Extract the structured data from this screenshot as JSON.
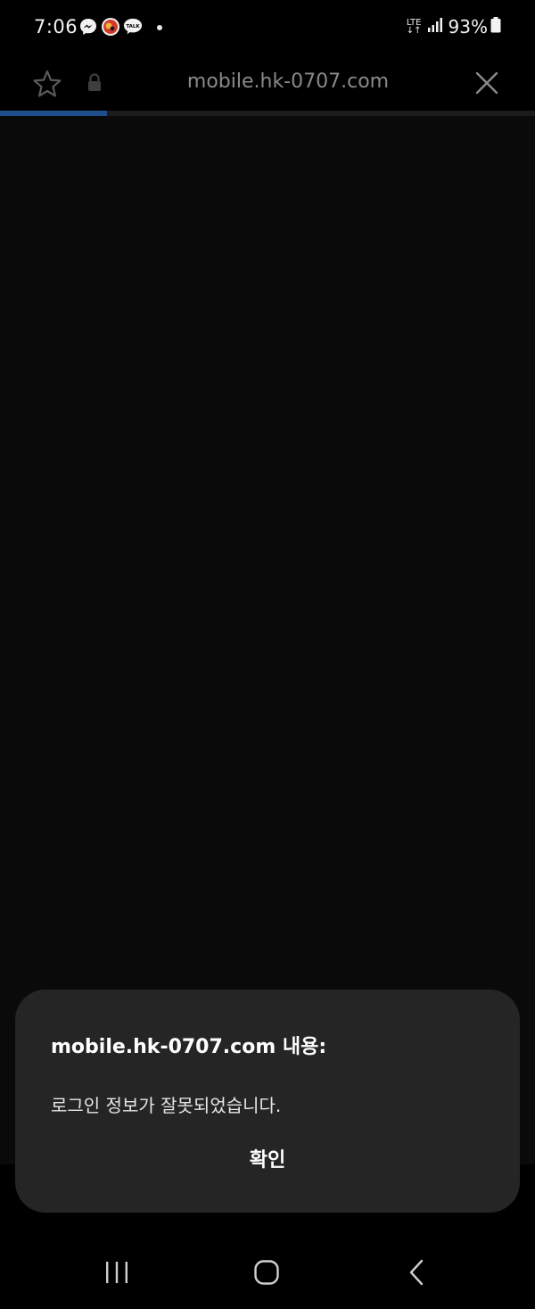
{
  "status_bar": {
    "time": "7:06",
    "notification_icons": [
      "messenger-icon",
      "app-badge-icon",
      "kakaotalk-icon"
    ],
    "kakao_label": "TALK",
    "network_label_top": "LTE",
    "network_label_bottom": "↓↑",
    "battery_percent": "93%"
  },
  "browser": {
    "url": "mobile.hk-0707.com",
    "load_progress": 0.2,
    "progress_color": "#1f4e8c"
  },
  "dialog": {
    "title": "mobile.hk-0707.com 내용:",
    "message": "로그인 정보가 잘못되었습니다.",
    "ok_label": "확인"
  },
  "colors": {
    "background": "#0a0a0a",
    "dialog_background": "#252525",
    "url_text": "#8a8a8a"
  }
}
